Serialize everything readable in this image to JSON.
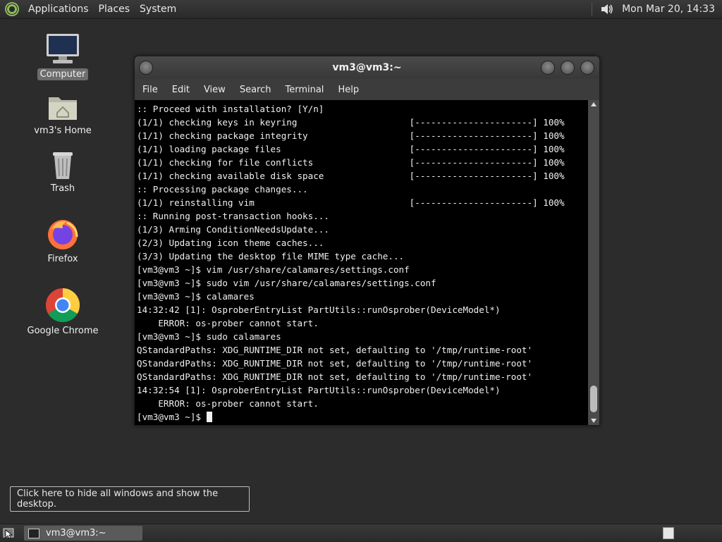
{
  "top_panel": {
    "menus": [
      "Applications",
      "Places",
      "System"
    ],
    "clock": "Mon Mar 20, 14:33"
  },
  "desktop_icons": [
    {
      "label": "Computer",
      "icon": "computer-icon"
    },
    {
      "label": "vm3's Home",
      "icon": "home-folder-icon"
    },
    {
      "label": "Trash",
      "icon": "trash-icon"
    },
    {
      "label": "Firefox",
      "icon": "firefox-icon"
    },
    {
      "label": "Google Chrome",
      "icon": "chrome-icon"
    }
  ],
  "window": {
    "title": "vm3@vm3:~",
    "menus": [
      "File",
      "Edit",
      "View",
      "Search",
      "Terminal",
      "Help"
    ]
  },
  "terminal_lines": [
    ":: Proceed with installation? [Y/n]",
    "(1/1) checking keys in keyring                     [----------------------] 100%",
    "(1/1) checking package integrity                   [----------------------] 100%",
    "(1/1) loading package files                        [----------------------] 100%",
    "(1/1) checking for file conflicts                  [----------------------] 100%",
    "(1/1) checking available disk space                [----------------------] 100%",
    ":: Processing package changes...",
    "(1/1) reinstalling vim                             [----------------------] 100%",
    ":: Running post-transaction hooks...",
    "(1/3) Arming ConditionNeedsUpdate...",
    "(2/3) Updating icon theme caches...",
    "(3/3) Updating the desktop file MIME type cache...",
    "[vm3@vm3 ~]$ vim /usr/share/calamares/settings.conf",
    "[vm3@vm3 ~]$ sudo vim /usr/share/calamares/settings.conf",
    "[vm3@vm3 ~]$ calamares",
    "14:32:42 [1]: OsproberEntryList PartUtils::runOsprober(DeviceModel*)",
    "    ERROR: os-prober cannot start.",
    "[vm3@vm3 ~]$ sudo calamares",
    "QStandardPaths: XDG_RUNTIME_DIR not set, defaulting to '/tmp/runtime-root'",
    "QStandardPaths: XDG_RUNTIME_DIR not set, defaulting to '/tmp/runtime-root'",
    "QStandardPaths: XDG_RUNTIME_DIR not set, defaulting to '/tmp/runtime-root'",
    "14:32:54 [1]: OsproberEntryList PartUtils::runOsprober(DeviceModel*)",
    "    ERROR: os-prober cannot start.",
    "[vm3@vm3 ~]$ "
  ],
  "tooltip": "Click here to hide all windows and show the desktop.",
  "taskbar": {
    "task_label": "vm3@vm3:~"
  }
}
